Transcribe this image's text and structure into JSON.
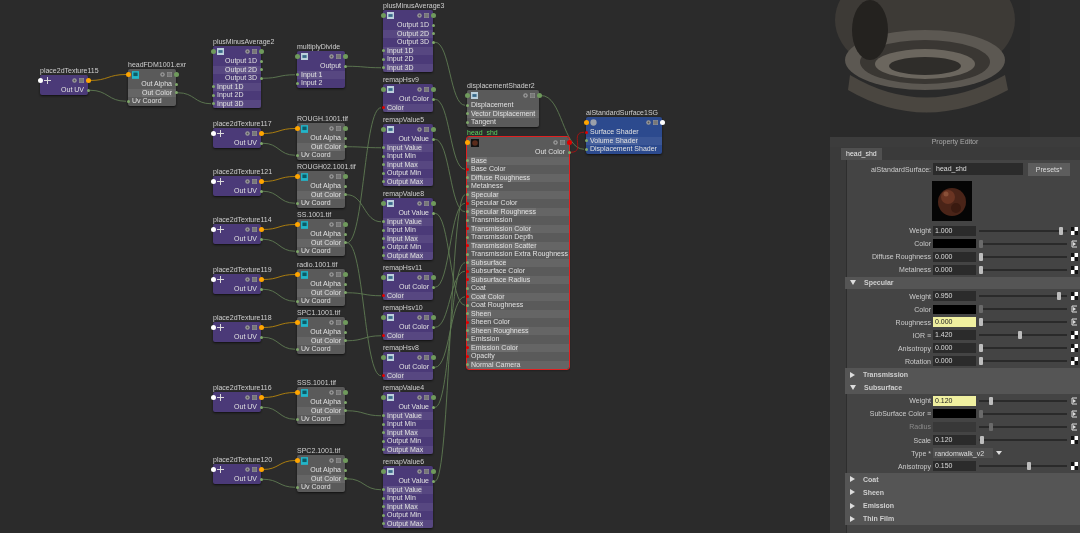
{
  "graph": {
    "nodes": [
      {
        "title": "place2dTexture115",
        "kind": "place2d",
        "selected": false,
        "rows": [
          {
            "label": "Out UV",
            "output": true
          }
        ]
      },
      {
        "title": "headFDM1001.exr",
        "kind": "file",
        "selected": false,
        "rows": [
          {
            "label": "Out Alpha",
            "output": true
          },
          {
            "label": "Out Color",
            "output": true
          },
          {
            "label": "Uv Coord",
            "output": false
          }
        ]
      },
      {
        "title": "plusMinusAverage2",
        "kind": "utility",
        "selected": false,
        "rows": [
          {
            "label": "Output 1D",
            "output": true
          },
          {
            "label": "Output 2D",
            "output": true
          },
          {
            "label": "Output 3D",
            "output": true
          },
          {
            "label": "Input 1D",
            "output": false
          },
          {
            "label": "Input 2D",
            "output": false
          },
          {
            "label": "Input 3D",
            "output": false
          }
        ]
      },
      {
        "title": "place2dTexture117",
        "kind": "place2d",
        "selected": false,
        "rows": [
          {
            "label": "Out UV",
            "output": true
          }
        ]
      },
      {
        "title": "place2dTexture121",
        "kind": "place2d",
        "selected": false,
        "rows": [
          {
            "label": "Out UV",
            "output": true
          }
        ]
      },
      {
        "title": "place2dTexture114",
        "kind": "place2d",
        "selected": false,
        "rows": [
          {
            "label": "Out UV",
            "output": true
          }
        ]
      },
      {
        "title": "place2dTexture119",
        "kind": "place2d",
        "selected": false,
        "rows": [
          {
            "label": "Out UV",
            "output": true
          }
        ]
      },
      {
        "title": "place2dTexture118",
        "kind": "place2d",
        "selected": false,
        "rows": [
          {
            "label": "Out UV",
            "output": true
          }
        ]
      },
      {
        "title": "place2dTexture116",
        "kind": "place2d",
        "selected": false,
        "rows": [
          {
            "label": "Out UV",
            "output": true
          }
        ]
      },
      {
        "title": "place2dTexture120",
        "kind": "place2d",
        "selected": false,
        "rows": [
          {
            "label": "Out UV",
            "output": true
          }
        ]
      },
      {
        "title": "multiplyDivide",
        "kind": "utility",
        "selected": false,
        "rows": [
          {
            "label": "Output",
            "output": true
          },
          {
            "label": "Input 1",
            "output": false
          },
          {
            "label": "Input 2",
            "output": false
          }
        ]
      },
      {
        "title": "ROUGH.1001.tif",
        "kind": "file",
        "selected": false,
        "rows": [
          {
            "label": "Out Alpha",
            "output": true
          },
          {
            "label": "Out Color",
            "output": true
          },
          {
            "label": "Uv Coord",
            "output": false
          }
        ]
      },
      {
        "title": "ROUGH02.1001.tif",
        "kind": "file",
        "selected": false,
        "rows": [
          {
            "label": "Out Alpha",
            "output": true
          },
          {
            "label": "Out Color",
            "output": true
          },
          {
            "label": "Uv Coord",
            "output": false
          }
        ]
      },
      {
        "title": "SS.1001.tif",
        "kind": "file",
        "selected": false,
        "rows": [
          {
            "label": "Out Alpha",
            "output": true
          },
          {
            "label": "Out Color",
            "output": true
          },
          {
            "label": "Uv Coord",
            "output": false
          }
        ]
      },
      {
        "title": "radio.1001.tif",
        "kind": "file",
        "selected": false,
        "rows": [
          {
            "label": "Out Alpha",
            "output": true
          },
          {
            "label": "Out Color",
            "output": true
          },
          {
            "label": "Uv Coord",
            "output": false
          }
        ]
      },
      {
        "title": "SPC1.1001.tif",
        "kind": "file",
        "selected": false,
        "rows": [
          {
            "label": "Out Alpha",
            "output": true
          },
          {
            "label": "Out Color",
            "output": true
          },
          {
            "label": "Uv Coord",
            "output": false
          }
        ]
      },
      {
        "title": "SSS.1001.tif",
        "kind": "file",
        "selected": false,
        "rows": [
          {
            "label": "Out Alpha",
            "output": true
          },
          {
            "label": "Out Color",
            "output": true
          },
          {
            "label": "Uv Coord",
            "output": false
          }
        ]
      },
      {
        "title": "SPC2.1001.tif",
        "kind": "file",
        "selected": false,
        "rows": [
          {
            "label": "Out Alpha",
            "output": true
          },
          {
            "label": "Out Color",
            "output": true
          },
          {
            "label": "Uv Coord",
            "output": false
          }
        ]
      },
      {
        "title": "plusMinusAverage3",
        "kind": "utility",
        "selected": false,
        "rows": [
          {
            "label": "Output 1D",
            "output": true
          },
          {
            "label": "Output 2D",
            "output": true
          },
          {
            "label": "Output 3D",
            "output": true
          },
          {
            "label": "Input 1D",
            "output": false
          },
          {
            "label": "Input 2D",
            "output": false
          },
          {
            "label": "Input 3D",
            "output": false
          }
        ]
      },
      {
        "title": "remapHsv9",
        "kind": "utility",
        "selected": false,
        "rows": [
          {
            "label": "Out Color",
            "output": true
          },
          {
            "label": "Color",
            "output": false,
            "color_port": true
          }
        ]
      },
      {
        "title": "remapValue5",
        "kind": "utility",
        "selected": false,
        "rows": [
          {
            "label": "Out Value",
            "output": true
          },
          {
            "label": "Input Value",
            "output": false
          },
          {
            "label": "Input Min",
            "output": false
          },
          {
            "label": "Input Max",
            "output": false
          },
          {
            "label": "Output Min",
            "output": false
          },
          {
            "label": "Output Max",
            "output": false
          }
        ]
      },
      {
        "title": "remapValue8",
        "kind": "utility",
        "selected": false,
        "rows": [
          {
            "label": "Out Value",
            "output": true
          },
          {
            "label": "Input Value",
            "output": false
          },
          {
            "label": "Input Min",
            "output": false
          },
          {
            "label": "Input Max",
            "output": false
          },
          {
            "label": "Output Min",
            "output": false
          },
          {
            "label": "Output Max",
            "output": false
          }
        ]
      },
      {
        "title": "remapHsv11",
        "kind": "utility",
        "selected": false,
        "rows": [
          {
            "label": "Out Color",
            "output": true
          },
          {
            "label": "Color",
            "output": false,
            "color_port": true
          }
        ]
      },
      {
        "title": "remapHsv10",
        "kind": "utility",
        "selected": false,
        "rows": [
          {
            "label": "Out Color",
            "output": true
          },
          {
            "label": "Color",
            "output": false,
            "color_port": true
          }
        ]
      },
      {
        "title": "remapHsv8",
        "kind": "utility",
        "selected": false,
        "rows": [
          {
            "label": "Out Color",
            "output": true
          },
          {
            "label": "Color",
            "output": false,
            "color_port": true
          }
        ]
      },
      {
        "title": "remapValue4",
        "kind": "utility",
        "selected": false,
        "rows": [
          {
            "label": "Out Value",
            "output": true
          },
          {
            "label": "Input Value",
            "output": false
          },
          {
            "label": "Input Min",
            "output": false
          },
          {
            "label": "Input Max",
            "output": false
          },
          {
            "label": "Output Min",
            "output": false
          },
          {
            "label": "Output Max",
            "output": false
          }
        ]
      },
      {
        "title": "remapValue6",
        "kind": "utility",
        "selected": false,
        "rows": [
          {
            "label": "Out Value",
            "output": true
          },
          {
            "label": "Input Value",
            "output": false
          },
          {
            "label": "Input Min",
            "output": false
          },
          {
            "label": "Input Max",
            "output": false
          },
          {
            "label": "Output Min",
            "output": false
          },
          {
            "label": "Output Max",
            "output": false
          }
        ]
      },
      {
        "title": "displacementShader2",
        "kind": "displacement",
        "selected": false,
        "rows": [
          {
            "label": "Displacement",
            "output": false
          },
          {
            "label": "Vector Displacement",
            "output": false
          },
          {
            "label": "Tangent",
            "output": false
          }
        ]
      },
      {
        "title": "head_shd",
        "kind": "shader",
        "selected": true,
        "rows": [
          {
            "label": "Out Color",
            "output": true
          },
          {
            "label": "Base",
            "output": false
          },
          {
            "label": "Base Color",
            "output": false,
            "color_port": true
          },
          {
            "label": "Diffuse Roughness",
            "output": false
          },
          {
            "label": "Metalness",
            "output": false
          },
          {
            "label": "Specular",
            "output": false
          },
          {
            "label": "Specular Color",
            "output": false,
            "color_port": true
          },
          {
            "label": "Specular Roughness",
            "output": false
          },
          {
            "label": "Transmission",
            "output": false
          },
          {
            "label": "Transmission Color",
            "output": false,
            "color_port": true
          },
          {
            "label": "Transmission Depth",
            "output": false
          },
          {
            "label": "Transmission Scatter",
            "output": false,
            "color_port": true
          },
          {
            "label": "Transmission Extra Roughness",
            "output": false
          },
          {
            "label": "Subsurface",
            "output": false
          },
          {
            "label": "Subsurface Color",
            "output": false,
            "color_port": true
          },
          {
            "label": "Subsurface Radius",
            "output": false,
            "color_port": true
          },
          {
            "label": "Coat",
            "output": false
          },
          {
            "label": "Coat Color",
            "output": false,
            "color_port": true
          },
          {
            "label": "Coat Roughness",
            "output": false
          },
          {
            "label": "Sheen",
            "output": false
          },
          {
            "label": "Sheen Color",
            "output": false,
            "color_port": true
          },
          {
            "label": "Sheen Roughness",
            "output": false
          },
          {
            "label": "Emission",
            "output": false
          },
          {
            "label": "Emission Color",
            "output": false,
            "color_port": true
          },
          {
            "label": "Opacity",
            "output": false,
            "color_port": true
          },
          {
            "label": "Normal Camera",
            "output": false
          }
        ]
      },
      {
        "title": "aiStandardSurface1SG",
        "kind": "shading_group",
        "selected": false,
        "rows": [
          {
            "label": "Surface Shader",
            "output": false,
            "color_port": true
          },
          {
            "label": "Volume Shader",
            "output": false
          },
          {
            "label": "Displacement Shader",
            "output": false
          }
        ]
      }
    ]
  },
  "property_editor": {
    "title": "Property Editor",
    "tab": "head_shd",
    "type_label": "aiStandardSurface:",
    "name": "head_shd",
    "presets": "Presets*",
    "rows": [
      {
        "kind": "slider",
        "label": "Weight",
        "value": "1.000",
        "level": 0.95,
        "highlighted": false,
        "connected": false
      },
      {
        "kind": "color",
        "label": "Color",
        "color": "#000000",
        "level": 0,
        "connected": true
      },
      {
        "kind": "slider",
        "label": "Diffuse Roughness",
        "value": "0.000",
        "level": 0,
        "highlighted": false,
        "connected": false
      },
      {
        "kind": "slider",
        "label": "Metalness",
        "value": "0.000",
        "level": 0,
        "highlighted": false,
        "connected": false
      },
      {
        "kind": "section",
        "label": "Specular",
        "expanded": true
      },
      {
        "kind": "slider",
        "label": "Weight",
        "value": "0.950",
        "level": 0.93,
        "highlighted": false,
        "connected": false
      },
      {
        "kind": "color",
        "label": "Color",
        "color": "#000000",
        "level": 0,
        "connected": true
      },
      {
        "kind": "slider",
        "label": "Roughness",
        "value": "0.000",
        "level": 0,
        "highlighted": true,
        "connected": true
      },
      {
        "kind": "slider",
        "label": "IOR ≡",
        "value": "1.420",
        "level": 0.46,
        "highlighted": false,
        "connected": false
      },
      {
        "kind": "slider",
        "label": "Anisotropy",
        "value": "0.000",
        "level": 0,
        "highlighted": false,
        "connected": false
      },
      {
        "kind": "slider",
        "label": "Rotation",
        "value": "0.000",
        "level": 0,
        "highlighted": false,
        "connected": false
      },
      {
        "kind": "section",
        "label": "Transmission",
        "expanded": false
      },
      {
        "kind": "section",
        "label": "Subsurface",
        "expanded": true
      },
      {
        "kind": "slider",
        "label": "Weight",
        "value": "0.120",
        "level": 0.12,
        "highlighted": true,
        "connected": true
      },
      {
        "kind": "color",
        "label": "SubSurface Color ≡",
        "color": "#000000",
        "level": 0,
        "connected": true
      },
      {
        "kind": "disabled_slider",
        "label": "Radius",
        "level": 0.12,
        "connected": true
      },
      {
        "kind": "slider",
        "label": "Scale",
        "value": "0.120",
        "level": 0.01,
        "highlighted": false,
        "connected": false
      },
      {
        "kind": "dropdown",
        "label": "Type *",
        "value": "randomwalk_v2"
      },
      {
        "kind": "slider",
        "label": "Anisotropy",
        "value": "0.150",
        "level": 0.57,
        "highlighted": false,
        "connected": false
      },
      {
        "kind": "section",
        "label": "Coat",
        "expanded": false
      },
      {
        "kind": "section",
        "label": "Sheen",
        "expanded": false
      },
      {
        "kind": "section",
        "label": "Emission",
        "expanded": false
      },
      {
        "kind": "section",
        "label": "Thin Film",
        "expanded": false
      }
    ]
  }
}
